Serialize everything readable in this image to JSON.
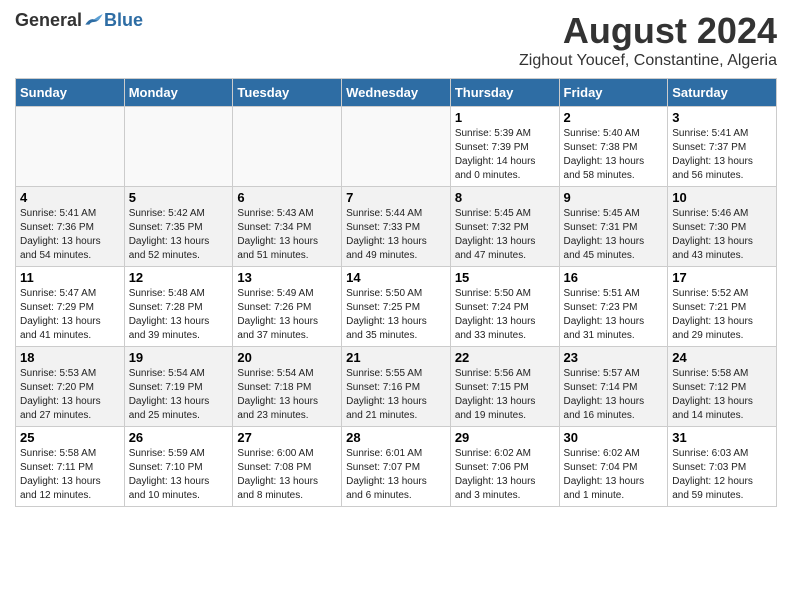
{
  "header": {
    "logo_general": "General",
    "logo_blue": "Blue",
    "month_title": "August 2024",
    "location": "Zighout Youcef, Constantine, Algeria"
  },
  "days_of_week": [
    "Sunday",
    "Monday",
    "Tuesday",
    "Wednesday",
    "Thursday",
    "Friday",
    "Saturday"
  ],
  "weeks": [
    {
      "days": [
        {
          "number": "",
          "empty": true
        },
        {
          "number": "",
          "empty": true
        },
        {
          "number": "",
          "empty": true
        },
        {
          "number": "",
          "empty": true
        },
        {
          "number": "1",
          "sunrise": "Sunrise: 5:39 AM",
          "sunset": "Sunset: 7:39 PM",
          "daylight": "Daylight: 14 hours and 0 minutes."
        },
        {
          "number": "2",
          "sunrise": "Sunrise: 5:40 AM",
          "sunset": "Sunset: 7:38 PM",
          "daylight": "Daylight: 13 hours and 58 minutes."
        },
        {
          "number": "3",
          "sunrise": "Sunrise: 5:41 AM",
          "sunset": "Sunset: 7:37 PM",
          "daylight": "Daylight: 13 hours and 56 minutes."
        }
      ]
    },
    {
      "days": [
        {
          "number": "4",
          "sunrise": "Sunrise: 5:41 AM",
          "sunset": "Sunset: 7:36 PM",
          "daylight": "Daylight: 13 hours and 54 minutes."
        },
        {
          "number": "5",
          "sunrise": "Sunrise: 5:42 AM",
          "sunset": "Sunset: 7:35 PM",
          "daylight": "Daylight: 13 hours and 52 minutes."
        },
        {
          "number": "6",
          "sunrise": "Sunrise: 5:43 AM",
          "sunset": "Sunset: 7:34 PM",
          "daylight": "Daylight: 13 hours and 51 minutes."
        },
        {
          "number": "7",
          "sunrise": "Sunrise: 5:44 AM",
          "sunset": "Sunset: 7:33 PM",
          "daylight": "Daylight: 13 hours and 49 minutes."
        },
        {
          "number": "8",
          "sunrise": "Sunrise: 5:45 AM",
          "sunset": "Sunset: 7:32 PM",
          "daylight": "Daylight: 13 hours and 47 minutes."
        },
        {
          "number": "9",
          "sunrise": "Sunrise: 5:45 AM",
          "sunset": "Sunset: 7:31 PM",
          "daylight": "Daylight: 13 hours and 45 minutes."
        },
        {
          "number": "10",
          "sunrise": "Sunrise: 5:46 AM",
          "sunset": "Sunset: 7:30 PM",
          "daylight": "Daylight: 13 hours and 43 minutes."
        }
      ]
    },
    {
      "days": [
        {
          "number": "11",
          "sunrise": "Sunrise: 5:47 AM",
          "sunset": "Sunset: 7:29 PM",
          "daylight": "Daylight: 13 hours and 41 minutes."
        },
        {
          "number": "12",
          "sunrise": "Sunrise: 5:48 AM",
          "sunset": "Sunset: 7:28 PM",
          "daylight": "Daylight: 13 hours and 39 minutes."
        },
        {
          "number": "13",
          "sunrise": "Sunrise: 5:49 AM",
          "sunset": "Sunset: 7:26 PM",
          "daylight": "Daylight: 13 hours and 37 minutes."
        },
        {
          "number": "14",
          "sunrise": "Sunrise: 5:50 AM",
          "sunset": "Sunset: 7:25 PM",
          "daylight": "Daylight: 13 hours and 35 minutes."
        },
        {
          "number": "15",
          "sunrise": "Sunrise: 5:50 AM",
          "sunset": "Sunset: 7:24 PM",
          "daylight": "Daylight: 13 hours and 33 minutes."
        },
        {
          "number": "16",
          "sunrise": "Sunrise: 5:51 AM",
          "sunset": "Sunset: 7:23 PM",
          "daylight": "Daylight: 13 hours and 31 minutes."
        },
        {
          "number": "17",
          "sunrise": "Sunrise: 5:52 AM",
          "sunset": "Sunset: 7:21 PM",
          "daylight": "Daylight: 13 hours and 29 minutes."
        }
      ]
    },
    {
      "days": [
        {
          "number": "18",
          "sunrise": "Sunrise: 5:53 AM",
          "sunset": "Sunset: 7:20 PM",
          "daylight": "Daylight: 13 hours and 27 minutes."
        },
        {
          "number": "19",
          "sunrise": "Sunrise: 5:54 AM",
          "sunset": "Sunset: 7:19 PM",
          "daylight": "Daylight: 13 hours and 25 minutes."
        },
        {
          "number": "20",
          "sunrise": "Sunrise: 5:54 AM",
          "sunset": "Sunset: 7:18 PM",
          "daylight": "Daylight: 13 hours and 23 minutes."
        },
        {
          "number": "21",
          "sunrise": "Sunrise: 5:55 AM",
          "sunset": "Sunset: 7:16 PM",
          "daylight": "Daylight: 13 hours and 21 minutes."
        },
        {
          "number": "22",
          "sunrise": "Sunrise: 5:56 AM",
          "sunset": "Sunset: 7:15 PM",
          "daylight": "Daylight: 13 hours and 19 minutes."
        },
        {
          "number": "23",
          "sunrise": "Sunrise: 5:57 AM",
          "sunset": "Sunset: 7:14 PM",
          "daylight": "Daylight: 13 hours and 16 minutes."
        },
        {
          "number": "24",
          "sunrise": "Sunrise: 5:58 AM",
          "sunset": "Sunset: 7:12 PM",
          "daylight": "Daylight: 13 hours and 14 minutes."
        }
      ]
    },
    {
      "days": [
        {
          "number": "25",
          "sunrise": "Sunrise: 5:58 AM",
          "sunset": "Sunset: 7:11 PM",
          "daylight": "Daylight: 13 hours and 12 minutes."
        },
        {
          "number": "26",
          "sunrise": "Sunrise: 5:59 AM",
          "sunset": "Sunset: 7:10 PM",
          "daylight": "Daylight: 13 hours and 10 minutes."
        },
        {
          "number": "27",
          "sunrise": "Sunrise: 6:00 AM",
          "sunset": "Sunset: 7:08 PM",
          "daylight": "Daylight: 13 hours and 8 minutes."
        },
        {
          "number": "28",
          "sunrise": "Sunrise: 6:01 AM",
          "sunset": "Sunset: 7:07 PM",
          "daylight": "Daylight: 13 hours and 6 minutes."
        },
        {
          "number": "29",
          "sunrise": "Sunrise: 6:02 AM",
          "sunset": "Sunset: 7:06 PM",
          "daylight": "Daylight: 13 hours and 3 minutes."
        },
        {
          "number": "30",
          "sunrise": "Sunrise: 6:02 AM",
          "sunset": "Sunset: 7:04 PM",
          "daylight": "Daylight: 13 hours and 1 minute."
        },
        {
          "number": "31",
          "sunrise": "Sunrise: 6:03 AM",
          "sunset": "Sunset: 7:03 PM",
          "daylight": "Daylight: 12 hours and 59 minutes."
        }
      ]
    }
  ]
}
